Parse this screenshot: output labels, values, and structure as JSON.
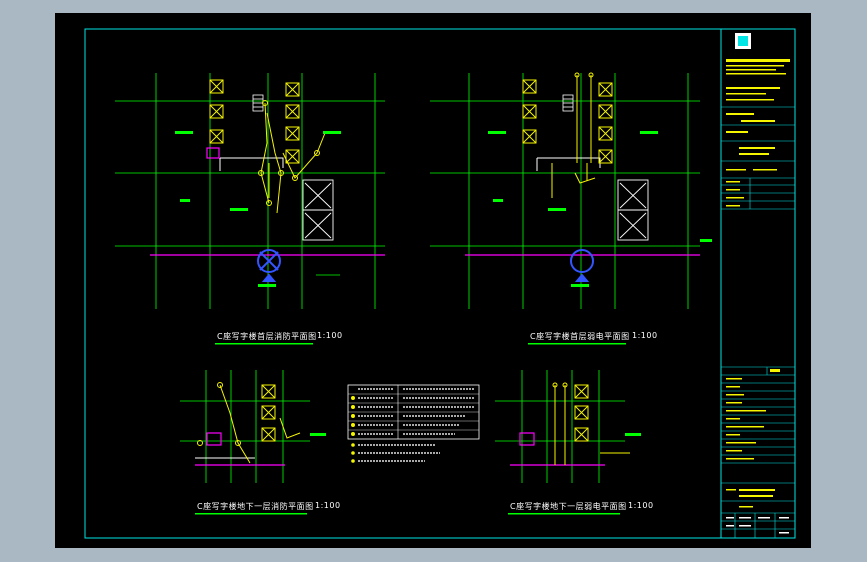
{
  "drawings": {
    "plan_top_left_title": "C座写字楼首层消防平面图",
    "plan_top_right_title": "C座写字楼首层弱电平面图",
    "plan_bottom_left_title": "C座写字楼地下一层消防平面图",
    "plan_bottom_right_title": "C座写字楼地下一层弱电平面图",
    "scale": "1:100"
  },
  "colors": {
    "frame": "#00e5e5",
    "axis": "#00ff00",
    "equipment": "#f5f500",
    "wall": "#ff00ff",
    "stairs": "#ffffff",
    "door": "#3355ff",
    "background": "#000000",
    "desktop": "#a9b8c3"
  }
}
